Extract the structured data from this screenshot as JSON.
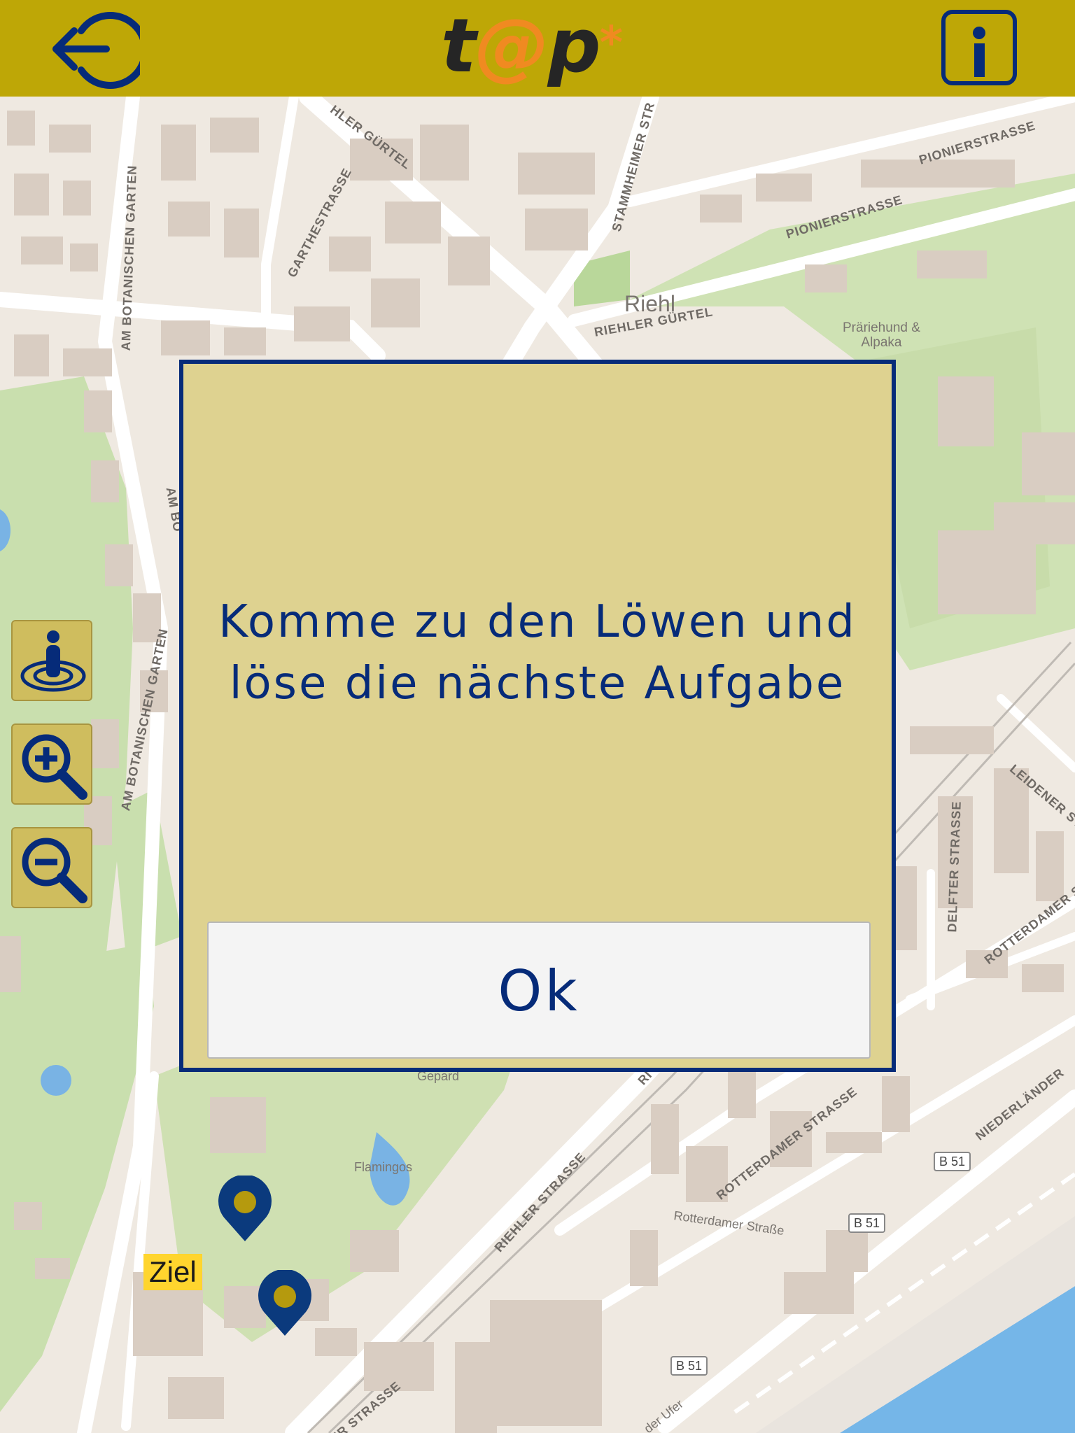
{
  "header": {
    "logo_prefix": "t",
    "logo_at": "@",
    "logo_suffix": "p",
    "logo_star": "*",
    "back_icon": "logout-arrow-icon",
    "info_icon": "info-icon"
  },
  "colors": {
    "header_bg": "#bea706",
    "accent_blue": "#062b79",
    "logo_orange": "#f08a21",
    "dialog_bg": "#ded290",
    "control_bg": "#cfbd5e",
    "marker_blue": "#0b3a7d",
    "marker_dot": "#b59a0e",
    "ziel_bg": "#ffd52e"
  },
  "map": {
    "streets": [
      "HLER GÜRTEL",
      "STAMMHEIMER STR",
      "PIONIERSTRASSE",
      "PIONIERSTRASSE",
      "GARTHESTRASSE",
      "AM BOTANISCHEN GARTEN",
      "RIEHLER GÜRTEL",
      "AM BO",
      "AM BOTANISCHEN GARTEN",
      "DELFTER STRASSE",
      "LEIDENER ST",
      "ROTTERDAMER ST",
      "ROTTERDAMER STRASSE",
      "RIEHLER STRASSE",
      "NIEDERLÄNDER",
      "RI",
      "ER STRASSE"
    ],
    "places": {
      "riehl": "Riehl",
      "alpaka_1": "Präriehund &",
      "alpaka_2": "Alpaka",
      "gepard": "Gepard",
      "flamingos": "Flamingos",
      "rotterdamer": "Rotterdamer Straße",
      "ufer": "der Ufer"
    },
    "route_badges": [
      "B 51",
      "B 51",
      "B 51"
    ],
    "ziel_label": "Ziel",
    "marker_icon": "map-pin-icon"
  },
  "controls": {
    "locate_icon": "locate-person-icon",
    "zoom_in_icon": "zoom-in-icon",
    "zoom_out_icon": "zoom-out-icon"
  },
  "dialog": {
    "message_line1": "Komme zu den Löwen und",
    "message_line2": "löse die nächste Aufgabe",
    "ok_label": "Ok"
  }
}
